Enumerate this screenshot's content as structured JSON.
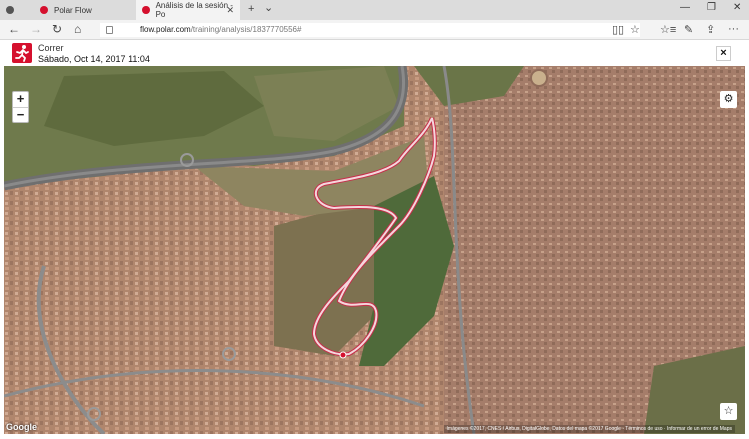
{
  "browser": {
    "tabs": [
      {
        "title": "Polar Flow",
        "active": false
      },
      {
        "title": "Análisis de la sesión - Po",
        "active": true
      }
    ],
    "new_tab": "+",
    "tab_list": "⌄",
    "url_host": "flow.polar.com",
    "url_path": "/training/analysis/1837770556#"
  },
  "session": {
    "sport": "Correr",
    "date": "Sábado, Oct 14, 2017 11:04"
  },
  "map": {
    "provider": "Google",
    "attribution": "Imágenes ©2017, CNES / Airbus, DigitalGlobe, Datos del mapa ©2017 Google · Términos de uso · Informar de un error de Maps"
  },
  "controls": {
    "zoom_in": "+",
    "zoom_out": "−",
    "close": "×",
    "settings": "⚙",
    "favorite": "☆"
  },
  "colors": {
    "brand": "#d5102e",
    "route": "#f4d6dc"
  }
}
